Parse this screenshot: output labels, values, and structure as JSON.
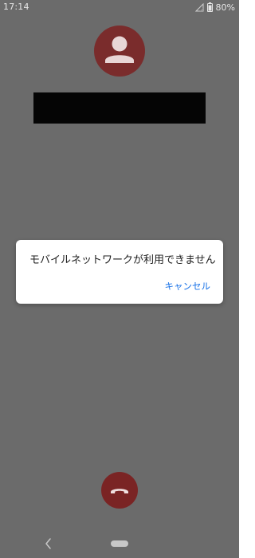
{
  "status_bar": {
    "time": "17:14",
    "battery_percent": "80%",
    "signal_icon": "signal-empty-icon",
    "battery_icon": "battery-icon"
  },
  "contact": {
    "avatar_icon": "person-icon"
  },
  "dialog": {
    "message": "モバイルネットワークが利用できません",
    "cancel_label": "キャンセル"
  },
  "call": {
    "end_call_icon": "phone-hangup-icon"
  },
  "nav": {
    "back_icon": "back-icon",
    "home_icon": "home-pill-icon"
  },
  "colors": {
    "background": "#6b6b6b",
    "avatar": "#7a2c2c",
    "end_call": "#7a2424",
    "accent": "#1a73e8"
  }
}
